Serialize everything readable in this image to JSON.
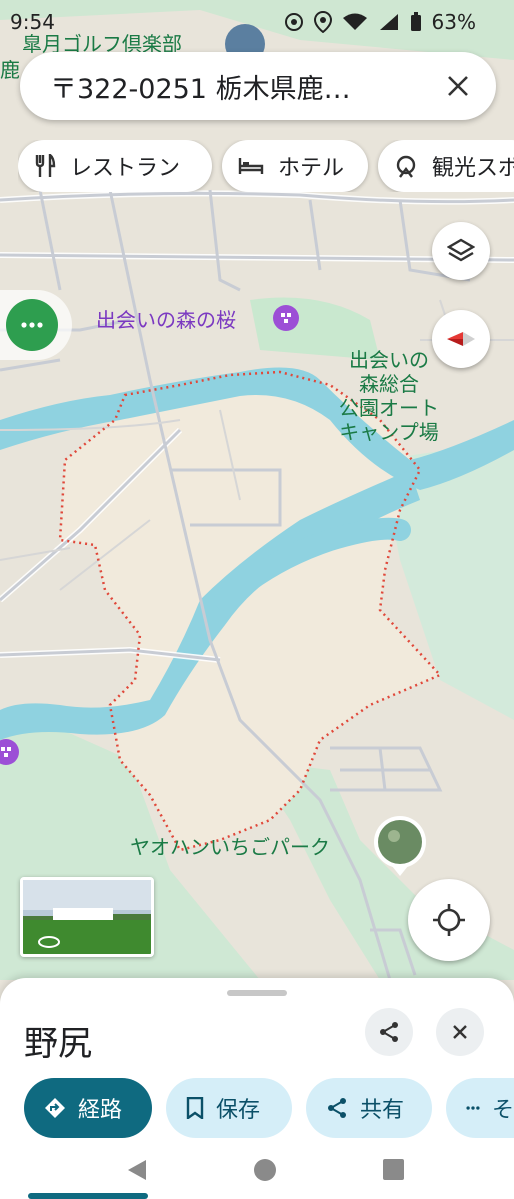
{
  "status_bar": {
    "time": "9:54",
    "battery": "63%"
  },
  "search": {
    "query": "〒322-0251 栃木県鹿…"
  },
  "chips": [
    {
      "label": "レストラン",
      "icon": "restaurant-icon"
    },
    {
      "label": "ホテル",
      "icon": "hotel-icon"
    },
    {
      "label": "観光スポ",
      "icon": "attraction-icon"
    }
  ],
  "map_labels": {
    "golf": "皐月ゴルフ倶楽部",
    "golf_partial": "鹿",
    "sakura": "出会いの森の桜",
    "campground": [
      "出会いの",
      "森総合",
      "公園オート",
      "キャンプ場"
    ],
    "strawberry": "ヤオハンいちごパーク"
  },
  "colors": {
    "accent": "#0f6a80",
    "water": "#8fd2e0",
    "boundary": "#e0483a",
    "park": "#c9e8cf",
    "poi_purple": "#9c4fd6"
  },
  "place_sheet": {
    "title": "野尻",
    "actions": [
      {
        "label": "経路",
        "icon": "directions-icon"
      },
      {
        "label": "保存",
        "icon": "bookmark-icon"
      },
      {
        "label": "共有",
        "icon": "share-icon"
      },
      {
        "label": "そ",
        "icon": "more-icon"
      }
    ]
  }
}
